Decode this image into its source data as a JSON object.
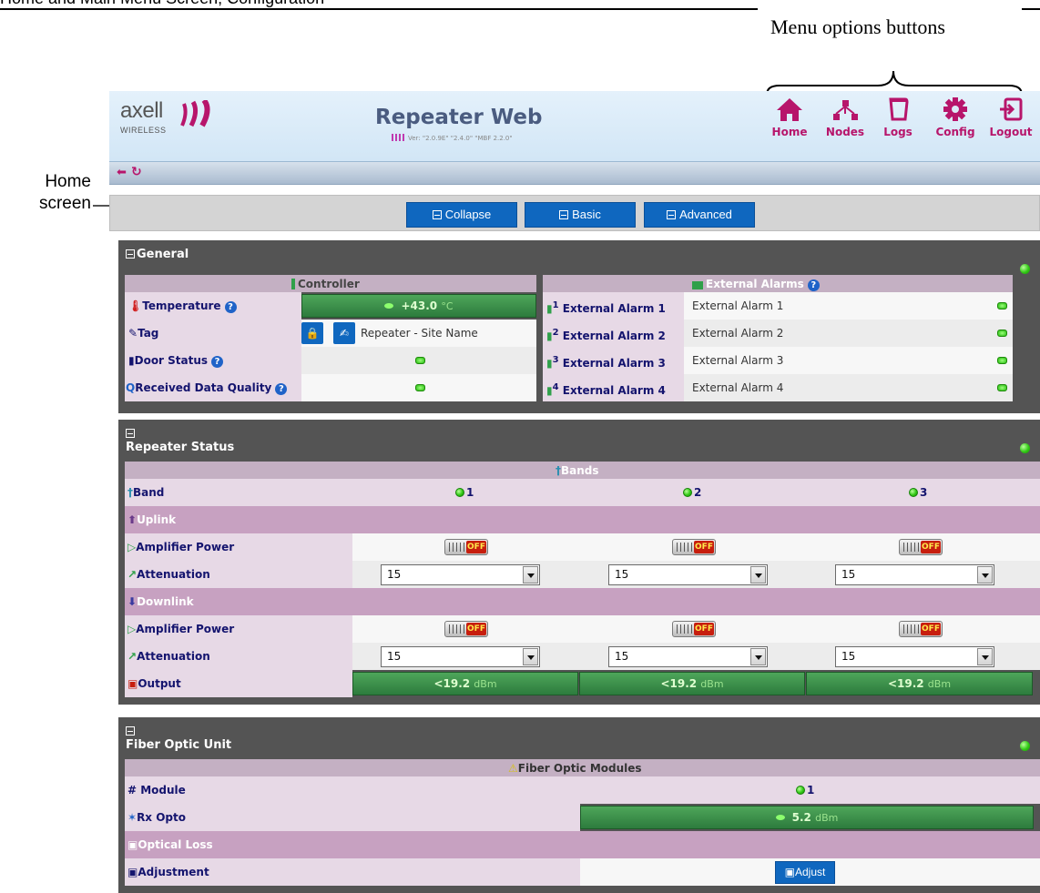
{
  "doc": {
    "header_text": "Home and Main Menu Screen; Configuration",
    "menu_callout": "Menu options buttons",
    "home_callout": "Home screen"
  },
  "app": {
    "logo_text": "axell",
    "logo_sub": "WIRELESS",
    "title": "Repeater Web",
    "version": "Ver: \"2.0.9E\" \"2.4.0\" \"MBF 2.2.0\"",
    "nav": [
      {
        "label": "Home",
        "icon": "home-icon"
      },
      {
        "label": "Nodes",
        "icon": "nodes-icon"
      },
      {
        "label": "Logs",
        "icon": "logs-icon"
      },
      {
        "label": "Config",
        "icon": "gear-icon"
      },
      {
        "label": "Logout",
        "icon": "logout-icon"
      }
    ],
    "view_buttons": {
      "collapse": "Collapse",
      "basic": "Basic",
      "advanced": "Advanced"
    }
  },
  "general": {
    "title": "General",
    "controller_header": "Controller",
    "alarms_header": "External Alarms",
    "rows": {
      "temperature": {
        "label": "Temperature",
        "value": "+43.0",
        "unit": "°C"
      },
      "tag": {
        "label": "Tag",
        "value": "Repeater - Site Name"
      },
      "door": {
        "label": "Door Status"
      },
      "rdq": {
        "label": "Received Data Quality"
      }
    },
    "alarms": [
      {
        "num": "1",
        "label": "External Alarm 1",
        "value": "External Alarm 1"
      },
      {
        "num": "2",
        "label": "External Alarm 2",
        "value": "External Alarm 2"
      },
      {
        "num": "3",
        "label": "External Alarm 3",
        "value": "External Alarm 3"
      },
      {
        "num": "4",
        "label": "External Alarm 4",
        "value": "External Alarm 4"
      }
    ]
  },
  "repeater": {
    "title": "Repeater Status",
    "bands_header": "Bands",
    "band_label": "Band",
    "bands": [
      "1",
      "2",
      "3"
    ],
    "uplink_label": "Uplink",
    "downlink_label": "Downlink",
    "amp_label": "Amplifier Power",
    "atten_label": "Attenuation",
    "off_label": "OFF",
    "atten_value": "15",
    "output_label": "Output",
    "output_value": "<19.2",
    "output_unit": "dBm"
  },
  "fiber": {
    "title": "Fiber Optic Unit",
    "modules_header": "Fiber Optic Modules",
    "module_label": "Module",
    "module_num": "1",
    "rx_label": "Rx Opto",
    "rx_value": "5.2",
    "rx_unit": "dBm",
    "loss_label": "Optical Loss",
    "adjust_label": "Adjustment",
    "adjust_button": "Adjust"
  }
}
